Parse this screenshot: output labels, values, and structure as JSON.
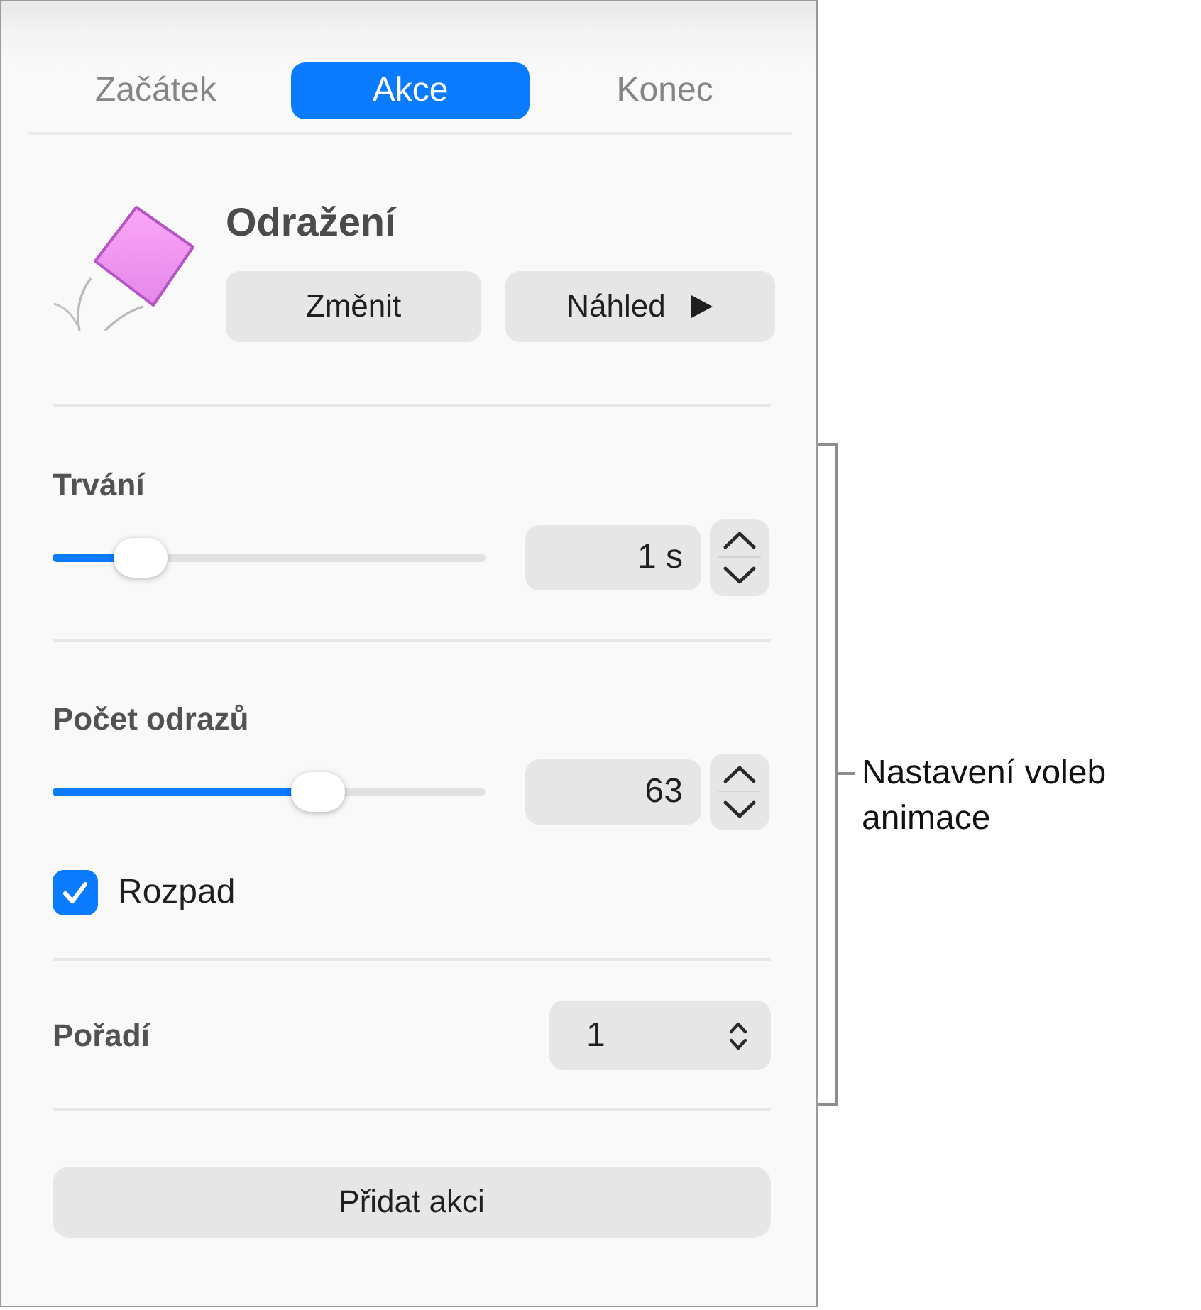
{
  "tabs": [
    {
      "label": "Začátek",
      "selected": false
    },
    {
      "label": "Akce",
      "selected": true
    },
    {
      "label": "Konec",
      "selected": false
    }
  ],
  "effect": {
    "title": "Odražení",
    "buttons": [
      {
        "label": "Změnit",
        "kind": "plain"
      },
      {
        "label": "Náhled",
        "kind": "play"
      }
    ]
  },
  "sections": [
    {
      "kind": "slider",
      "label": "Trvání",
      "level": 0.16,
      "value": "1 s"
    },
    {
      "kind": "slider",
      "label": "Počet odrazů",
      "level": 0.63,
      "value": "63",
      "checkbox": {
        "label": "Rozpad",
        "checked": true
      }
    },
    {
      "kind": "popup",
      "label": "Pořadí",
      "value": "1"
    }
  ],
  "add_button": {
    "label": "Přidat akci"
  },
  "callout": {
    "text": "Nastavení voleb animace"
  }
}
